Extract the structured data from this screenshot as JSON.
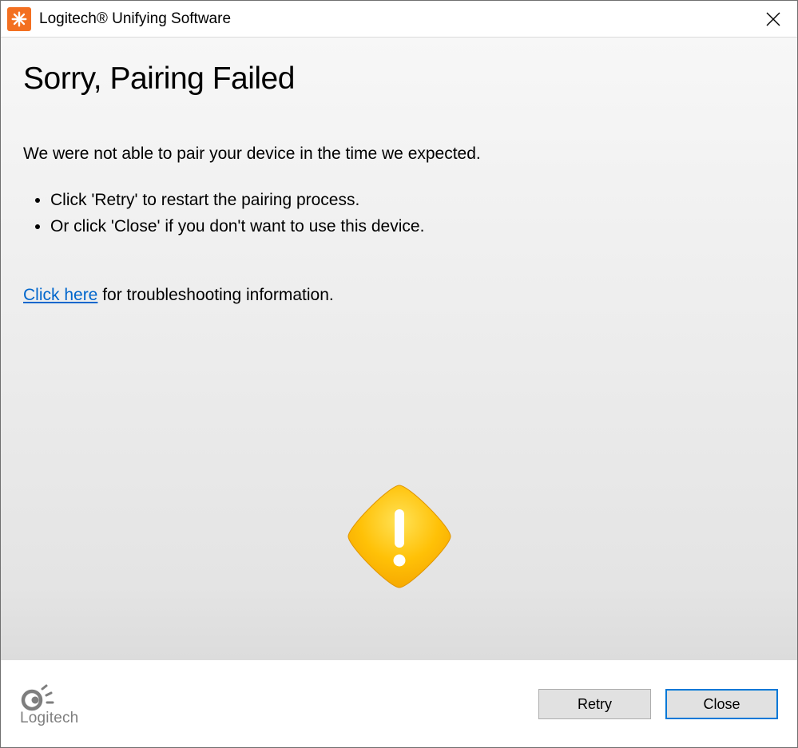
{
  "titlebar": {
    "title": "Logitech® Unifying Software"
  },
  "content": {
    "heading": "Sorry, Pairing Failed",
    "message": "We were not able to pair your device in the time we expected.",
    "bullets": [
      "Click 'Retry' to restart the pairing process.",
      "Or click 'Close' if you don't want to use this device."
    ],
    "troubleshoot_link": "Click here",
    "troubleshoot_text": " for troubleshooting information."
  },
  "footer": {
    "brand": "Logitech",
    "retry_label": "Retry",
    "close_label": "Close"
  }
}
